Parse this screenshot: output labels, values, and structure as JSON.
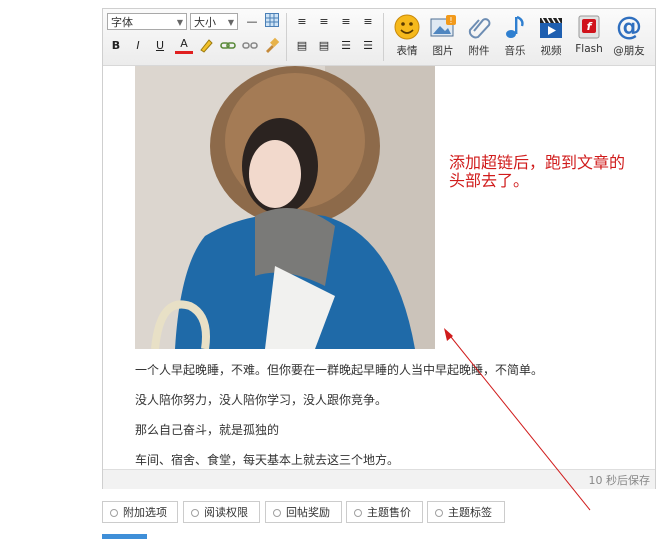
{
  "toolbar": {
    "font_select": "字体",
    "size_select": "大小",
    "bold": "B",
    "italic": "I",
    "underline": "U",
    "font_color": "A",
    "big_buttons": [
      {
        "label": "表情",
        "icon": "smiley-icon"
      },
      {
        "label": "图片",
        "icon": "image-icon"
      },
      {
        "label": "附件",
        "icon": "paperclip-icon"
      },
      {
        "label": "音乐",
        "icon": "music-note-icon"
      },
      {
        "label": "视频",
        "icon": "video-icon"
      },
      {
        "label": "Flash",
        "icon": "flash-icon"
      },
      {
        "label": "@朋友",
        "icon": "at-icon"
      }
    ]
  },
  "content": {
    "paragraphs": [
      "一个人早起晚睡，不难。但你要在一群晚起早睡的人当中早起晚睡，不简单。",
      "没人陪你努力，没人陪你学习，没人跟你竞争。",
      "那么自己奋斗，就是孤独的",
      "车间、宿舍、食堂，每天基本上就去这三个地方。"
    ]
  },
  "statusbar": {
    "autosave": "10 秒后保存"
  },
  "annotation": "添加超链后，跑到文章的头部去了。",
  "tabs": [
    "附加选项",
    "阅读权限",
    "回帖奖励",
    "主题售价",
    "主题标签"
  ],
  "colors": {
    "annotation": "#d01c1c",
    "accent": "#3f8fd8"
  }
}
